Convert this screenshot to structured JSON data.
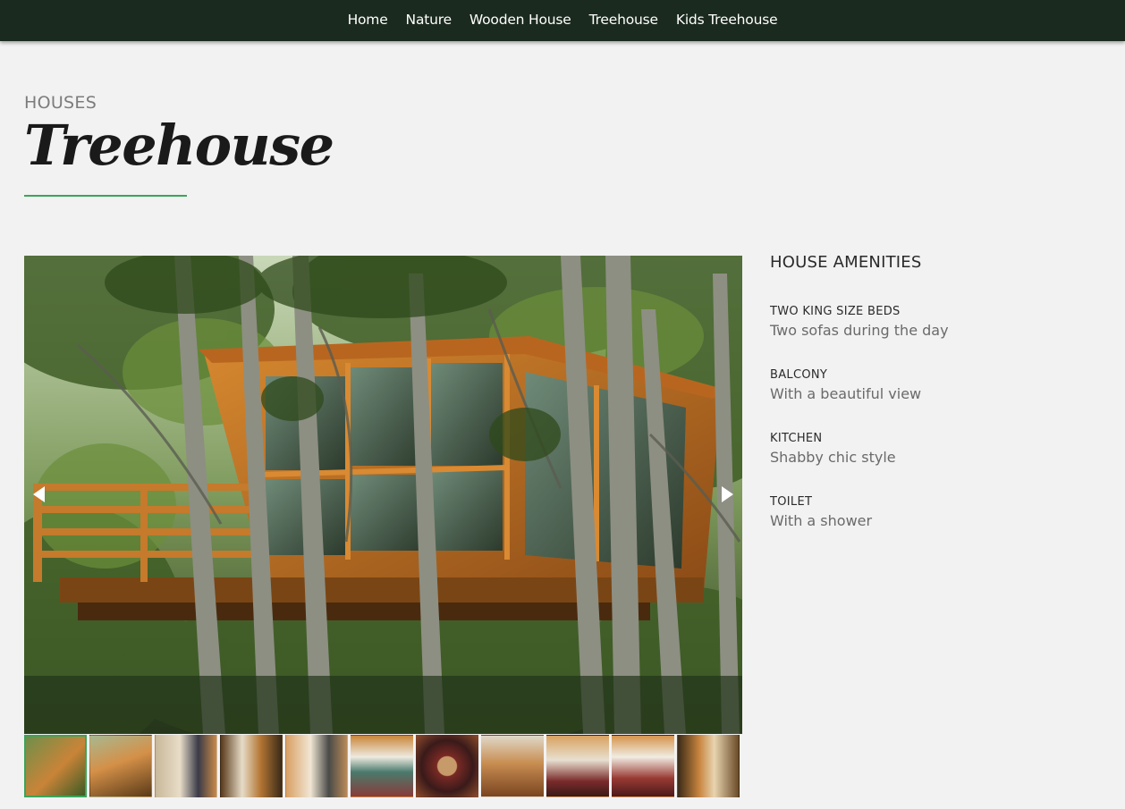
{
  "nav": {
    "items": [
      {
        "label": "Home"
      },
      {
        "label": "Nature"
      },
      {
        "label": "Wooden House"
      },
      {
        "label": "Treehouse"
      },
      {
        "label": "Kids Treehouse"
      }
    ]
  },
  "header": {
    "eyebrow": "HOUSES",
    "title": "Treehouse"
  },
  "gallery": {
    "prev_icon": "triangle-left-icon",
    "next_icon": "triangle-right-icon",
    "thumbnails": [
      {
        "name": "thumb-treehouse-exterior",
        "active": true
      },
      {
        "name": "thumb-stairs"
      },
      {
        "name": "thumb-woman-reading"
      },
      {
        "name": "thumb-balcony"
      },
      {
        "name": "thumb-woman-window"
      },
      {
        "name": "thumb-kitchen"
      },
      {
        "name": "thumb-rug-table"
      },
      {
        "name": "thumb-dining-table"
      },
      {
        "name": "thumb-round-table"
      },
      {
        "name": "thumb-sofa-rug"
      },
      {
        "name": "thumb-interior-door"
      },
      {
        "name": "thumb-exterior-partial"
      }
    ]
  },
  "amenities": {
    "heading": "HOUSE AMENITIES",
    "items": [
      {
        "label": "TWO KING SIZE BEDS",
        "desc": "Two sofas during the day"
      },
      {
        "label": "BALCONY",
        "desc": "With a beautiful view"
      },
      {
        "label": "KITCHEN",
        "desc": "Shabby chic style"
      },
      {
        "label": "TOILET",
        "desc": "With a shower"
      }
    ]
  },
  "colors": {
    "nav_bg": "#1b2a1e",
    "accent": "#3aa55a",
    "page_bg": "#f2f2f2"
  }
}
